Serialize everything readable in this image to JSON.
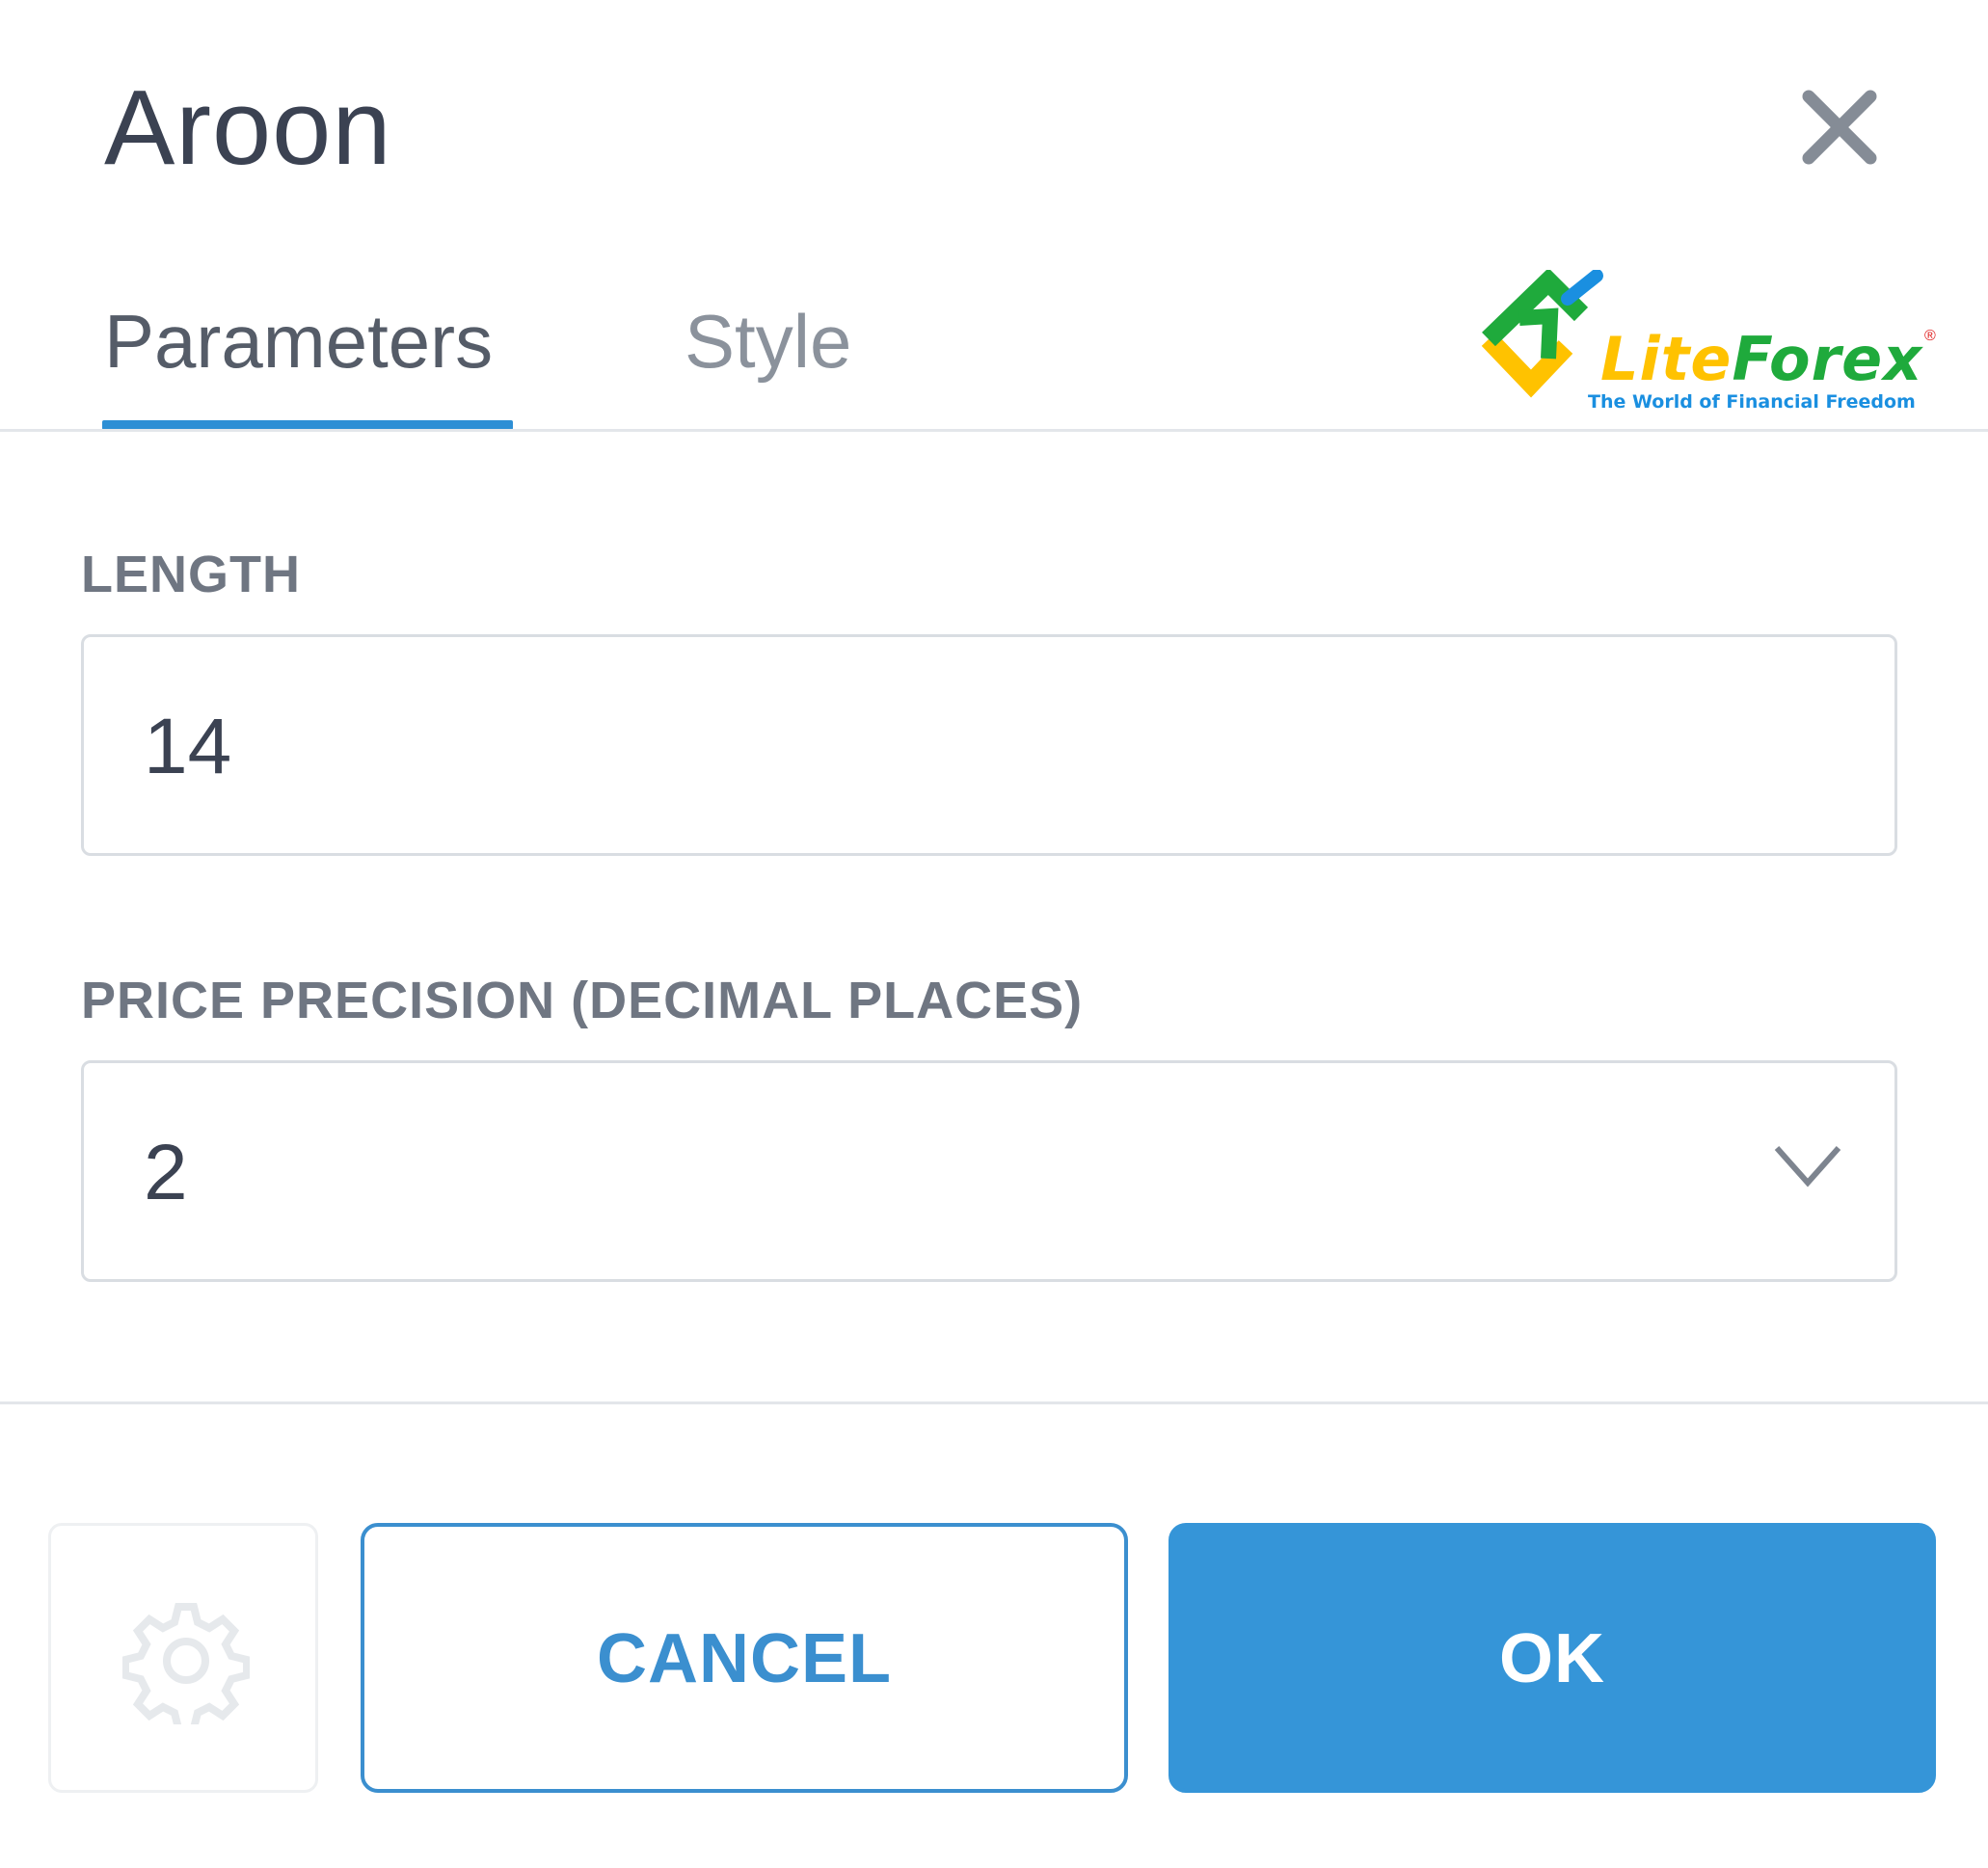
{
  "dialog": {
    "title": "Aroon",
    "close_icon": "close-icon"
  },
  "tabs": [
    {
      "label": "Parameters",
      "active": true
    },
    {
      "label": "Style",
      "active": false
    }
  ],
  "logo": {
    "name_part1": "Lite",
    "name_part2": "Forex",
    "registered": "®",
    "tagline": "The World of Financial Freedom"
  },
  "fields": {
    "length": {
      "label": "LENGTH",
      "value": "14"
    },
    "precision": {
      "label": "PRICE PRECISION (DECIMAL PLACES)",
      "value": "2",
      "icon": "chevron-down-icon"
    }
  },
  "footer": {
    "settings_icon": "gear-icon",
    "cancel_label": "CANCEL",
    "ok_label": "OK"
  },
  "colors": {
    "accent": "#3595d8",
    "tab_underline": "#2d8fd5",
    "title_text": "#3b4252",
    "logo_green": "#1faa3c",
    "logo_yellow": "#ffc200",
    "logo_blue": "#1a8fe0"
  }
}
